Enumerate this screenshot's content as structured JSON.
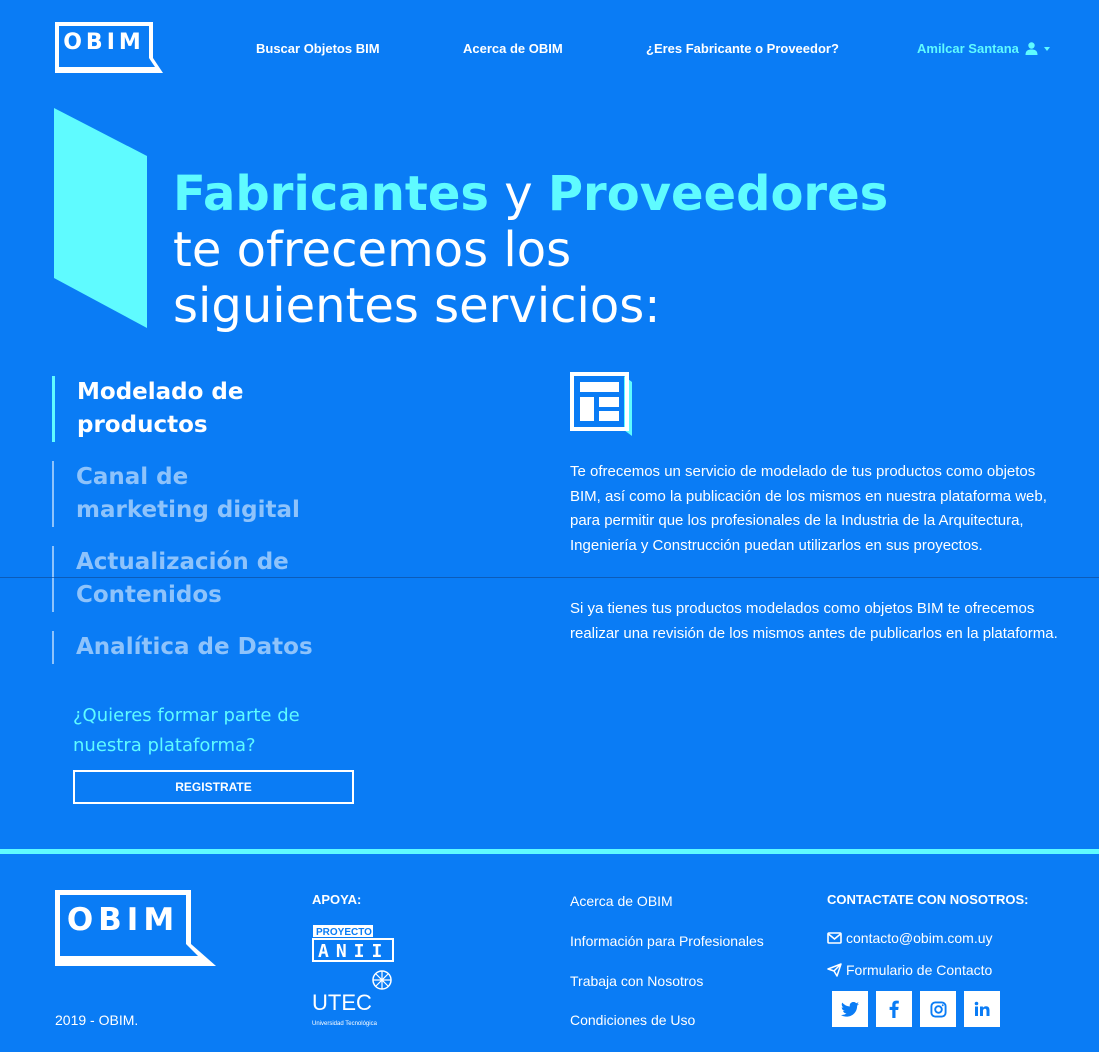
{
  "header": {
    "logo_text": "OBIM",
    "nav": {
      "search": "Buscar Objetos BIM",
      "about": "Acerca de OBIM",
      "manufacturer": "¿Eres Fabricante o Proveedor?"
    },
    "user_name": "Amilcar Santana"
  },
  "hero": {
    "highlight_1": "Fabricantes",
    "connector": " y ",
    "highlight_2": "Proveedores",
    "line_2": "te ofrecemos los",
    "line_3": "siguientes servicios:"
  },
  "services": {
    "items": [
      {
        "label_1": "Modelado de",
        "label_2": "productos"
      },
      {
        "label_1": "Canal de",
        "label_2": "marketing digital"
      },
      {
        "label_1": "Actualización de",
        "label_2": "Contenidos"
      },
      {
        "label_1": "Analítica de Datos",
        "label_2": ""
      }
    ],
    "join_line_1": "¿Quieres formar parte de",
    "join_line_2": "nuestra plataforma?",
    "register_label": "REGISTRATE"
  },
  "detail": {
    "icon": "layout-grid-icon",
    "paragraph_1": "Te ofrecemos un servicio de modelado de tus productos como objetos BIM, así como la publicación de los mismos en nuestra plataforma web, para permitir que los profesionales de la Industria de la Arquitectura, Ingeniería y Construcción puedan utilizarlos en sus proyectos.",
    "paragraph_2": "Si ya tienes tus productos modelados como objetos BIM te ofrecemos realizar una revisión de los mismos antes de publicarlos en la plataforma."
  },
  "footer": {
    "logo_text": "OBIM",
    "copyright": "2019 - OBIM.",
    "apoya_title": "APOYA:",
    "anii_top": "PROYECTO",
    "anii_bottom": "ANII",
    "utec_name": "UTEC",
    "utec_sub": "Universidad Tecnológica",
    "links": [
      "Acerca de OBIM",
      "Información para Profesionales",
      "Trabaja con Nosotros",
      "Condiciones de Uso"
    ],
    "contact_title": "CONTACTATE CON NOSOTROS:",
    "email": "contacto@obim.com.uy",
    "form": "Formulario de Contacto",
    "social": [
      "twitter-icon",
      "facebook-icon",
      "instagram-icon",
      "linkedin-icon"
    ]
  },
  "colors": {
    "background": "#0a7cf5",
    "accent": "#5ffbff",
    "muted": "#8ec3fb"
  }
}
